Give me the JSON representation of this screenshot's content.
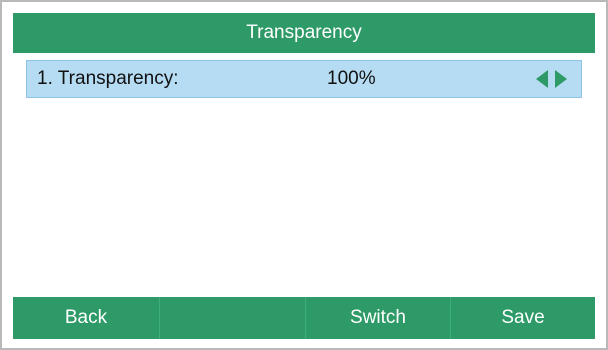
{
  "screen": {
    "title": "Transparency",
    "accent_color": "#2e9a67",
    "selection_color": "#b6dcf3"
  },
  "settings": {
    "items": [
      {
        "label": "1. Transparency:",
        "value": "100%",
        "controls": [
          "triangle-left-icon",
          "triangle-right-icon"
        ]
      }
    ]
  },
  "softkeys": {
    "key1": "Back",
    "key2": "",
    "key3": "Switch",
    "key4": "Save"
  }
}
